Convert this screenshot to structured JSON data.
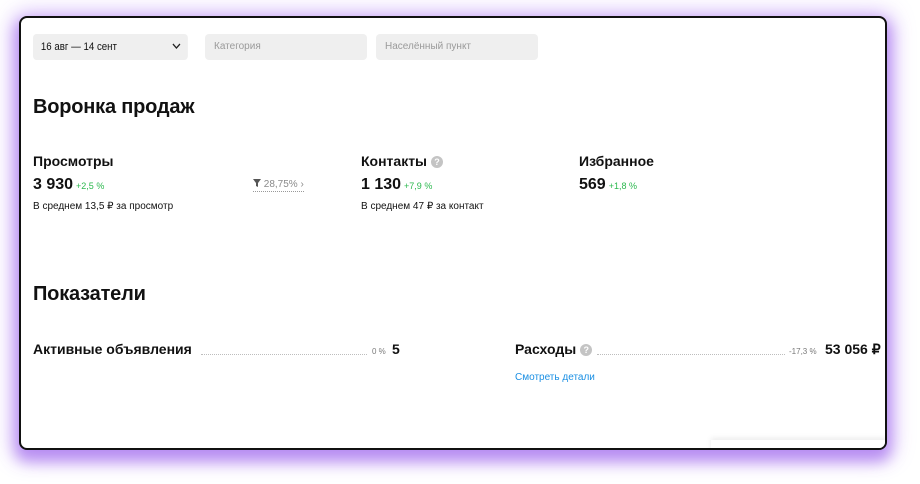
{
  "filters": {
    "date_range": "16 авг — 14 сент",
    "category_placeholder": "Категория",
    "location_placeholder": "Населённый пункт"
  },
  "funnel": {
    "title": "Воронка продаж",
    "views": {
      "label": "Просмотры",
      "value": "3 930",
      "delta": "+2,5 %",
      "note": "В среднем 13,5 ₽ за просмотр"
    },
    "conversion": "28,75%",
    "contacts": {
      "label": "Контакты",
      "value": "1 130",
      "delta": "+7,9 %",
      "note": "В среднем 47 ₽ за контакт"
    },
    "favorites": {
      "label": "Избранное",
      "value": "569",
      "delta": "+1,8 %"
    }
  },
  "metrics": {
    "title": "Показатели",
    "active_ads": {
      "label": "Активные объявления",
      "change": "0 %",
      "value": "5"
    },
    "expenses": {
      "label": "Расходы",
      "change": "-17,3 %",
      "value": "53 056 ₽",
      "details_link": "Смотреть детали"
    }
  },
  "colors": {
    "positive": "#2bb84e",
    "link": "#1a8fe3",
    "glow": "#a066f0"
  },
  "icons": {
    "help": "question-circle-icon",
    "dropdown": "chevron-down-icon",
    "funnel": "funnel-icon",
    "arrow": "chevron-right-icon"
  }
}
